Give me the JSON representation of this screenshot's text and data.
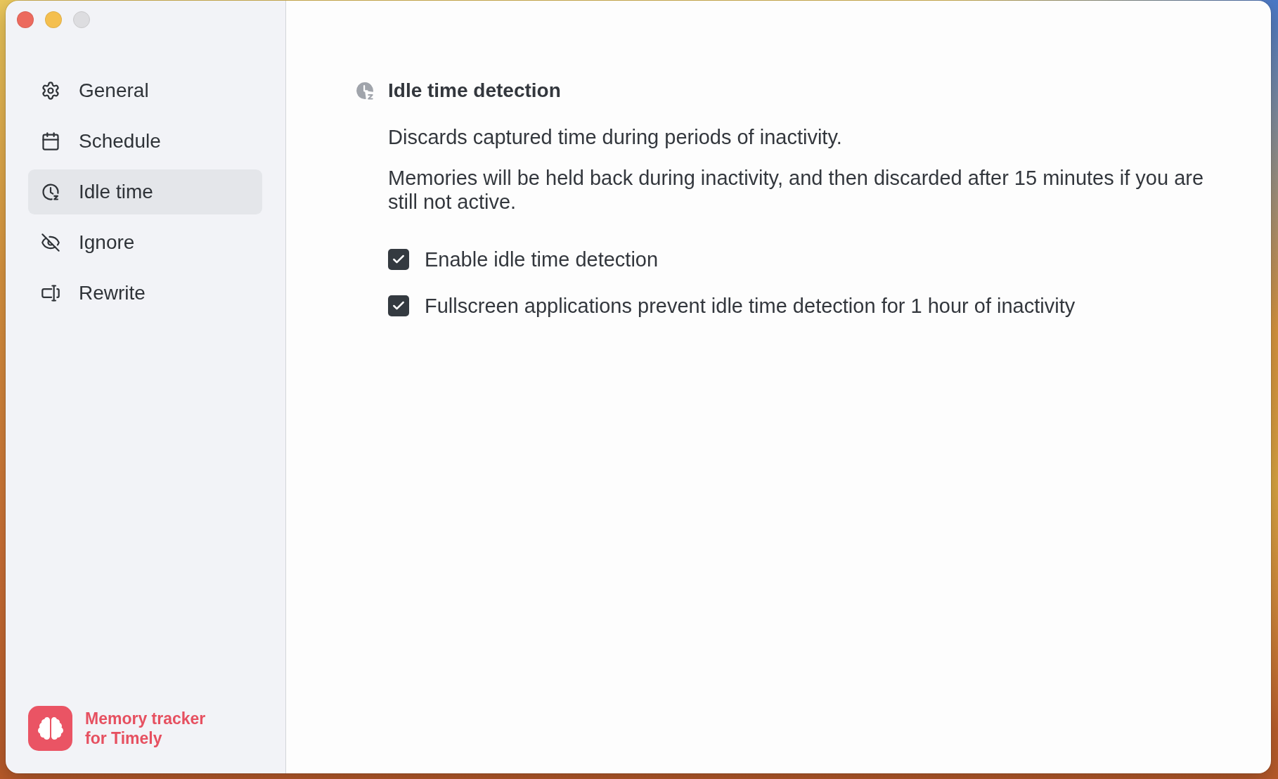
{
  "window": {
    "controls": [
      {
        "kind": "close",
        "disabled": false
      },
      {
        "kind": "minimize",
        "disabled": false
      },
      {
        "kind": "zoom",
        "disabled": true
      }
    ]
  },
  "sidebar": {
    "items": [
      {
        "label": "General",
        "selected": false
      },
      {
        "label": "Schedule",
        "selected": false
      },
      {
        "label": "Idle time",
        "selected": true
      },
      {
        "label": "Ignore",
        "selected": false
      },
      {
        "label": "Rewrite",
        "selected": false
      }
    ],
    "brand": {
      "name": "Memory tracker for Timely"
    }
  },
  "content": {
    "title": "Idle time detection",
    "paragraphs": [
      "Discards captured time during periods of inactivity.",
      "Memories will be held back during inactivity, and then discarded after 15 minutes if you are still not active."
    ],
    "options": [
      {
        "label": "Enable idle time detection",
        "checked": true
      },
      {
        "label": "Fullscreen applications prevent idle time detection for 1 hour of inactivity",
        "checked": true
      }
    ]
  }
}
